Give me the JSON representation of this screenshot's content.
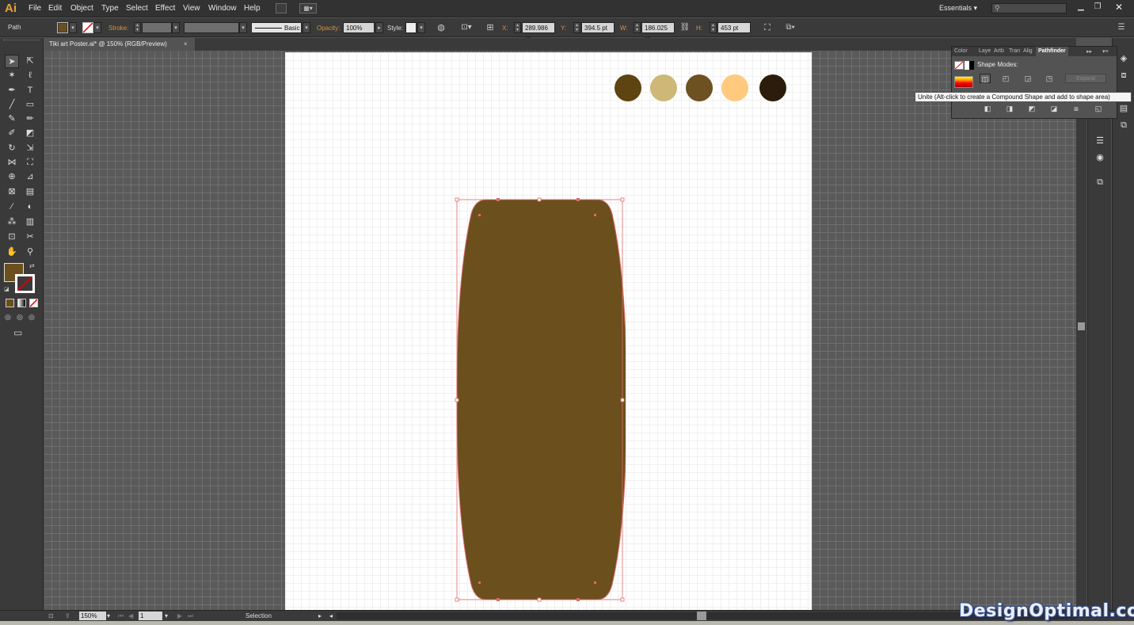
{
  "app": {
    "logo": "Ai",
    "workspace": "Essentials",
    "search_placeholder": ""
  },
  "menu": [
    "File",
    "Edit",
    "Object",
    "Type",
    "Select",
    "Effect",
    "View",
    "Window",
    "Help"
  ],
  "control_bar": {
    "object_type": "Path",
    "stroke_label": "Stroke:",
    "brush_label": "Basic",
    "opacity_label": "Opacity:",
    "opacity_value": "100%",
    "style_label": "Style:",
    "x_label": "X:",
    "x_value": "289.986 pt",
    "y_label": "Y:",
    "y_value": "394.5 pt",
    "w_label": "W:",
    "w_value": "186.025 pt",
    "h_label": "H:",
    "h_value": "453 pt",
    "fill_color": "#6b4f1d"
  },
  "document_tab": {
    "title": "Tiki art Poster.ai* @ 150% (RGB/Preview)",
    "close": "×"
  },
  "tools": {
    "fill_color": "#6b4f1d",
    "icons": [
      "selection-icon",
      "direct-selection-icon",
      "magic-wand-icon",
      "lasso-icon",
      "pen-icon",
      "type-icon",
      "line-icon",
      "rectangle-icon",
      "paintbrush-icon",
      "pencil-icon",
      "blob-brush-icon",
      "eraser-icon",
      "rotate-icon",
      "scale-icon",
      "width-icon",
      "free-transform-icon",
      "shape-builder-icon",
      "perspective-icon",
      "mesh-icon",
      "gradient-icon",
      "eyedropper-icon",
      "blend-icon",
      "symbol-sprayer-icon",
      "graph-icon",
      "artboard-icon",
      "slice-icon",
      "hand-icon",
      "zoom-icon"
    ]
  },
  "swatches_on_artboard": [
    "#5e4411",
    "#cdb878",
    "#6e5120",
    "#ffc97e",
    "#2b1c0b"
  ],
  "shape": {
    "fill": "#6b4f1d",
    "stroke": "#e06a6a"
  },
  "pathfinder_panel": {
    "tabs": [
      "Color",
      "Laye",
      "Artb",
      "Tran",
      "Alig",
      "Pathfinder"
    ],
    "active_tab": "Pathfinder",
    "shape_modes_label": "Shape Modes:",
    "expand_label": "Expand"
  },
  "tooltip": "Unite (Alt-click to create a Compound Shape and add to shape area)",
  "status_bar": {
    "zoom": "150%",
    "artboard_number": "1",
    "tool_status": "Selection"
  },
  "watermark": "DesignOptimal.com"
}
